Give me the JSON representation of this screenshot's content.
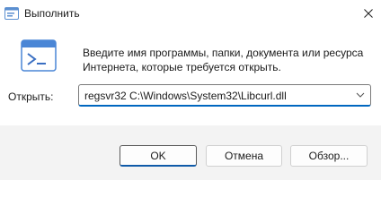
{
  "window": {
    "title": "Выполнить",
    "app_icon": "run-app-icon",
    "close_icon": "close-icon"
  },
  "dialog": {
    "icon": "run-icon",
    "description": "Введите имя программы, папки, документа или ресурса Интернета, которые требуется открыть.",
    "open_label": "Открыть:",
    "open_value": "regsvr32 C:\\Windows\\System32\\Libcurl.dll",
    "dropdown_icon": "chevron-down-icon"
  },
  "buttons": {
    "ok_label": "OK",
    "cancel_label": "Отмена",
    "browse_label": "Обзор..."
  },
  "colors": {
    "accent": "#0067c0",
    "footer_bg": "#f3f3f3"
  }
}
